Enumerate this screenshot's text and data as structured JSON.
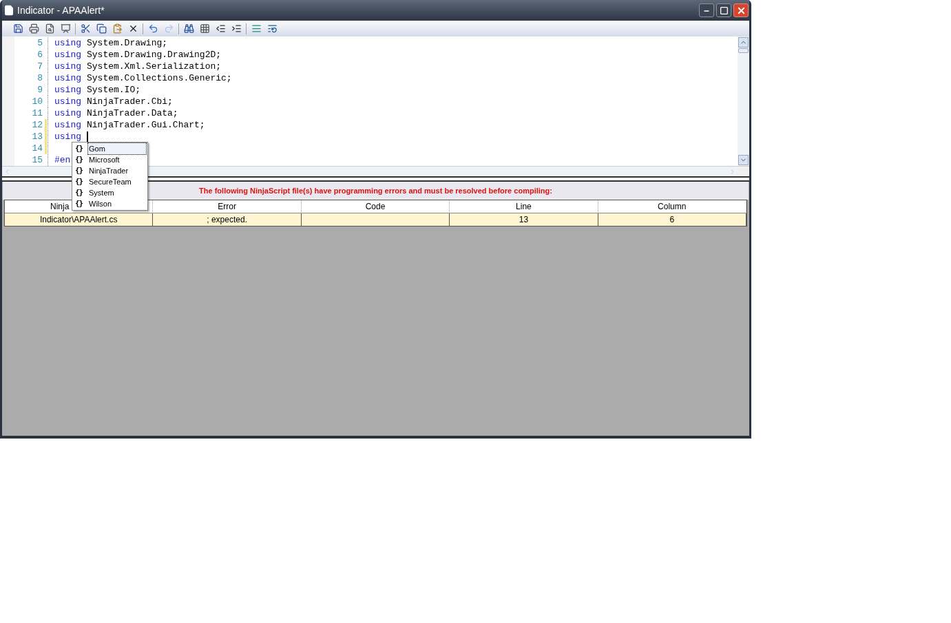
{
  "window": {
    "title": "Indicator - APAAlert*"
  },
  "toolbar": [
    {
      "disabled": false
    },
    {
      "disabled": false
    },
    {
      "disabled": false
    },
    {
      "disabled": false
    },
    {
      "disabled": false
    },
    {
      "disabled": false
    },
    {
      "disabled": false
    },
    {
      "disabled": false
    },
    {
      "disabled": false
    },
    {
      "disabled": true
    },
    {
      "disabled": false
    },
    {
      "disabled": false
    },
    {
      "disabled": false
    },
    {
      "disabled": false
    },
    {
      "disabled": false
    },
    {
      "disabled": false
    }
  ],
  "editor": {
    "lines": [
      {
        "number": "5",
        "keyword": "using",
        "text": "System.Drawing;",
        "modified": false
      },
      {
        "number": "6",
        "keyword": "using",
        "text": "System.Drawing.Drawing2D;",
        "modified": false
      },
      {
        "number": "7",
        "keyword": "using",
        "text": "System.Xml.Serialization;",
        "modified": false
      },
      {
        "number": "8",
        "keyword": "using",
        "text": "System.Collections.Generic;",
        "modified": false
      },
      {
        "number": "9",
        "keyword": "using",
        "text": "System.IO;",
        "modified": false
      },
      {
        "number": "10",
        "keyword": "using",
        "text": "NinjaTrader.Cbi;",
        "modified": false
      },
      {
        "number": "11",
        "keyword": "using",
        "text": "NinjaTrader.Data;",
        "modified": false
      },
      {
        "number": "12",
        "keyword": "using",
        "text": "NinjaTrader.Gui.Chart;",
        "modified": true
      },
      {
        "number": "13",
        "keyword": "using",
        "modified": true,
        "cursor": true
      },
      {
        "number": "14",
        "modified": true
      },
      {
        "number": "15",
        "keyword": "#en",
        "modified": false
      }
    ],
    "completion": [
      {
        "icon": "{}",
        "label": "Gom",
        "selected": true
      },
      {
        "icon": "{}",
        "label": "Microsoft",
        "selected": false
      },
      {
        "icon": "{}",
        "label": "NinjaTrader",
        "selected": false
      },
      {
        "icon": "{}",
        "label": "SecureTeam",
        "selected": false
      },
      {
        "icon": "{}",
        "label": "System",
        "selected": false
      },
      {
        "icon": "{}",
        "label": "Wilson",
        "selected": false
      }
    ]
  },
  "errors": {
    "message": "The following NinjaScript file(s) have programming errors and must be resolved before compiling:",
    "columns": [
      "Ninja",
      "Error",
      "Code",
      "Line",
      "Column"
    ],
    "rows": [
      [
        "Indicator\\APAAlert.cs",
        "; expected.",
        "",
        "13",
        "6"
      ]
    ]
  }
}
